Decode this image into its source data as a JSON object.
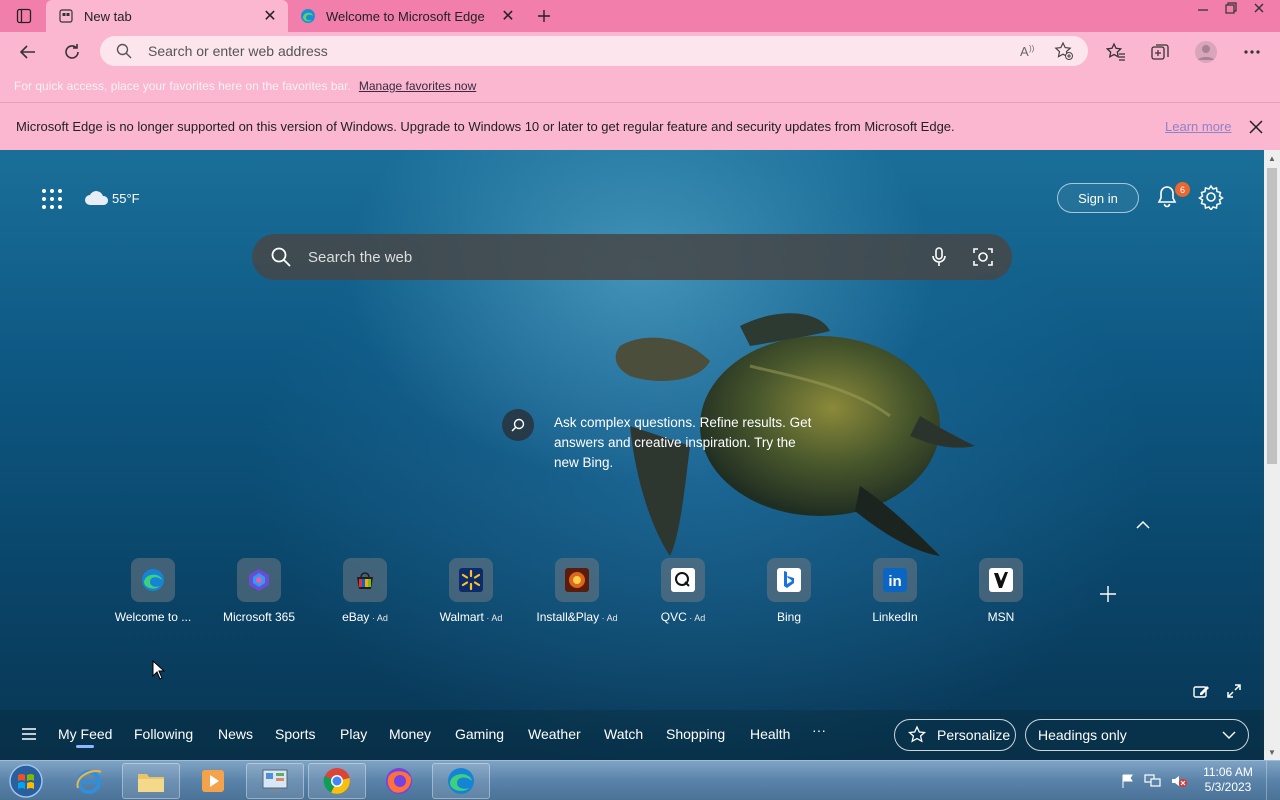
{
  "tabs": [
    {
      "title": "New tab",
      "icon": "newtab-icon",
      "active": true
    },
    {
      "title": "Welcome to Microsoft Edge",
      "icon": "edge-icon",
      "active": false
    }
  ],
  "addressbar": {
    "placeholder": "Search or enter web address"
  },
  "favorites_bar": {
    "hint": "For quick access, place your favorites here on the favorites bar.",
    "manage_link": "Manage favorites now"
  },
  "infobar": {
    "message": "Microsoft Edge is no longer supported on this version of Windows. Upgrade to Windows 10 or later to get regular feature and security updates from Microsoft Edge.",
    "learn_more": "Learn more"
  },
  "ntp": {
    "weather": "55°F",
    "sign_in": "Sign in",
    "notification_count": "6",
    "search_placeholder": "Search the web",
    "bing_promo": "Ask complex questions. Refine results. Get answers and creative inspiration. Try the new Bing."
  },
  "tiles": [
    {
      "label": "Welcome to ...",
      "ad": "",
      "icon": "edge-icon"
    },
    {
      "label": "Microsoft 365",
      "ad": "",
      "icon": "m365-icon"
    },
    {
      "label": "eBay",
      "ad": " · Ad",
      "icon": "ebay-icon"
    },
    {
      "label": "Walmart",
      "ad": " · Ad",
      "icon": "walmart-icon"
    },
    {
      "label": "Install&Play",
      "ad": " · Ad",
      "icon": "game-icon"
    },
    {
      "label": "QVC",
      "ad": " · Ad",
      "icon": "qvc-icon"
    },
    {
      "label": "Bing",
      "ad": "",
      "icon": "bing-icon"
    },
    {
      "label": "LinkedIn",
      "ad": "",
      "icon": "linkedin-icon"
    },
    {
      "label": "MSN",
      "ad": "",
      "icon": "msn-icon"
    }
  ],
  "feed_nav": {
    "items": [
      "My Feed",
      "Following",
      "News",
      "Sports",
      "Play",
      "Money",
      "Gaming",
      "Weather",
      "Watch",
      "Shopping",
      "Health"
    ],
    "more": "···",
    "personalize": "Personalize",
    "layout_select": "Headings only"
  },
  "taskbar": {
    "time": "11:06 AM",
    "date": "5/3/2023"
  },
  "colors": {
    "frame_pink": "#f27fab",
    "toolbar_pink": "#fbb7cf",
    "taskbar_blue": "#5a83aa"
  }
}
